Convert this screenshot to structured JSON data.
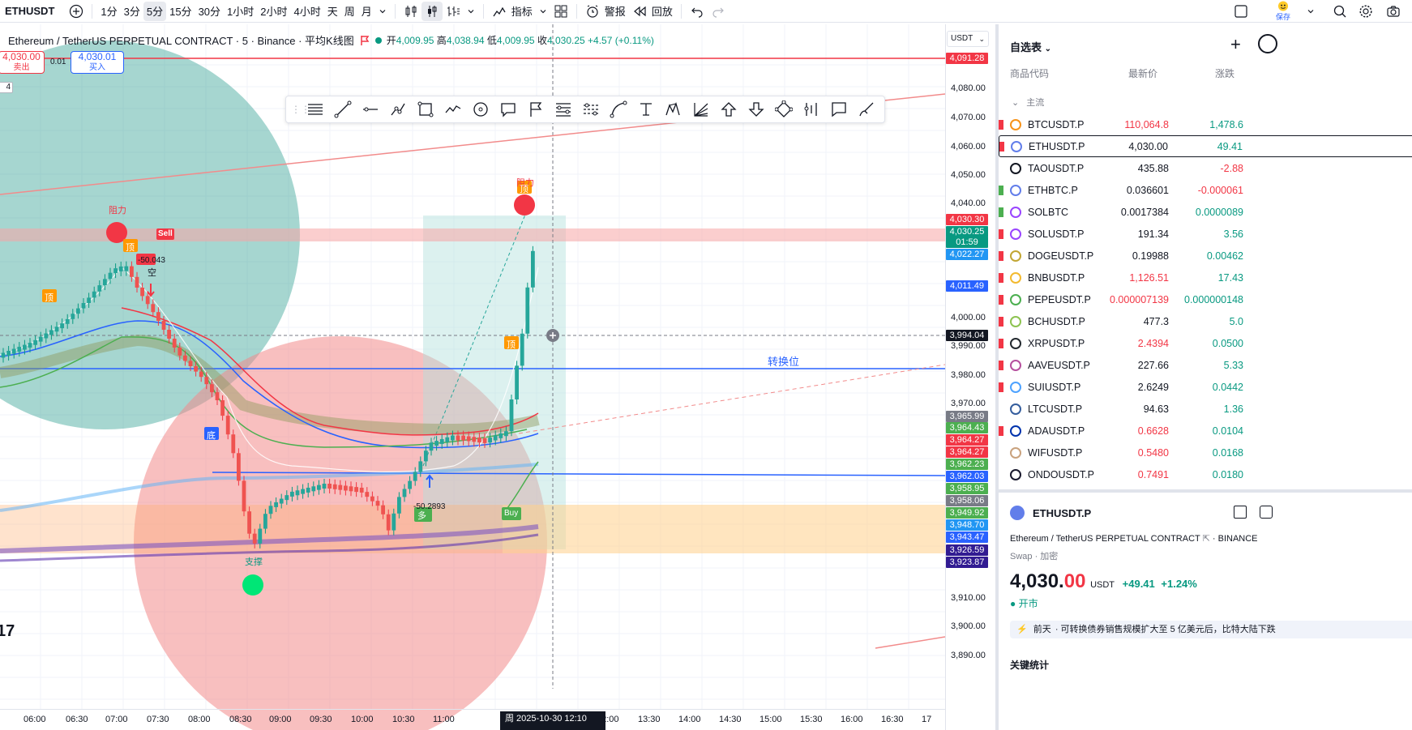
{
  "topbar": {
    "symbol": "ETHUSDT",
    "intervals": [
      "1分",
      "3分",
      "5分",
      "15分",
      "30分",
      "1小时",
      "2小时",
      "4小时",
      "天",
      "周",
      "月"
    ],
    "active_interval": "5分",
    "indicators": "指标",
    "alert": "警报",
    "replay": "回放",
    "save": "保存"
  },
  "legend": {
    "title": "Ethereum / TetherUS PERPETUAL CONTRACT · 5 · Binance · 平均K线图",
    "open_label": "开",
    "open": "4,009.95",
    "high_label": "高",
    "high": "4,038.94",
    "low_label": "低",
    "low": "4,009.95",
    "close_label": "收",
    "close": "4,030.25",
    "change": "+4.57 (+0.11%)"
  },
  "currency": "USDT",
  "orders": {
    "sell_price": "4,030.00",
    "sell_label": "卖出",
    "spread": "0.01",
    "buy_price": "4,030.01",
    "buy_label": "买入",
    "lots": "4"
  },
  "annotations": {
    "resistance_left": "阻力",
    "resistance_right": "阻力",
    "support": "支撑",
    "top": "顶",
    "bottom": "底",
    "sell": "Sell",
    "buy": "Buy",
    "short": "空",
    "long": "多",
    "short_value": "-50.043",
    "long_value": "-50.2893",
    "pivot": "转换位"
  },
  "price_axis": {
    "ticks": [
      "4,080.00",
      "4,070.00",
      "4,060.00",
      "4,050.00",
      "4,040.00",
      "4,000.00",
      "3,990.00",
      "3,980.00",
      "3,970.00",
      "3,910.00",
      "3,900.00",
      "3,890.00"
    ],
    "labels": [
      {
        "v": "4,091.28",
        "c": "#f23645"
      },
      {
        "v": "4,030.30",
        "c": "#f23645"
      },
      {
        "v": "4,030.25",
        "c": "#089981"
      },
      {
        "v": "01:59",
        "c": "#089981"
      },
      {
        "v": "4,022.27",
        "c": "#2196f3"
      },
      {
        "v": "4,011.49",
        "c": "#2962ff"
      },
      {
        "v": "3,994.04",
        "c": "#131722"
      },
      {
        "v": "3,965.99",
        "c": "#787b86"
      },
      {
        "v": "3,964.43",
        "c": "#4caf50"
      },
      {
        "v": "3,964.27",
        "c": "#f23645"
      },
      {
        "v": "3,964.27",
        "c": "#f23645"
      },
      {
        "v": "3,962.23",
        "c": "#4caf50"
      },
      {
        "v": "3,962.03",
        "c": "#2962ff"
      },
      {
        "v": "3,958.95",
        "c": "#4caf50"
      },
      {
        "v": "3,958.06",
        "c": "#787b86"
      },
      {
        "v": "3,949.92",
        "c": "#4caf50"
      },
      {
        "v": "3,948.70",
        "c": "#2196f3"
      },
      {
        "v": "3,943.47",
        "c": "#2962ff"
      },
      {
        "v": "3,926.59",
        "c": "#311b92"
      },
      {
        "v": "3,923.87",
        "c": "#311b92"
      }
    ]
  },
  "time_axis": {
    "ticks": [
      "06:00",
      "06:30",
      "07:00",
      "07:30",
      "08:00",
      "08:30",
      "09:00",
      "09:30",
      "10:00",
      "10:30",
      "11:00",
      "11:",
      "12:00",
      "13:30",
      "14:00",
      "14:30",
      "15:00",
      "15:30",
      "16:00",
      "16:30",
      "17"
    ],
    "cursor": "周 2025-10-30 12:10"
  },
  "watchlist": {
    "title": "自选表",
    "col_symbol": "商品代码",
    "col_last": "最新价",
    "col_change": "涨跌",
    "section": "主流",
    "rows": [
      {
        "sym": "BTCUSDT.P",
        "last": "110,064.8",
        "chg": "1,478.6",
        "lc": "dn",
        "cc": "up",
        "coin": "#f7931a",
        "flag": "#f23645"
      },
      {
        "sym": "ETHUSDT.P",
        "last": "4,030.00",
        "chg": "49.41",
        "lc": "plain",
        "cc": "up",
        "coin": "#627eea",
        "flag": "#f23645"
      },
      {
        "sym": "TAOUSDT.P",
        "last": "435.88",
        "chg": "-2.88",
        "lc": "plain",
        "cc": "dn",
        "coin": "#131722",
        "flag": ""
      },
      {
        "sym": "ETHBTC.P",
        "last": "0.036601",
        "chg": "-0.000061",
        "lc": "plain",
        "cc": "dn",
        "coin": "#627eea",
        "flag": "#4caf50"
      },
      {
        "sym": "SOLBTC",
        "last": "0.0017384",
        "chg": "0.0000089",
        "lc": "plain",
        "cc": "up",
        "coin": "#9945ff",
        "flag": "#4caf50"
      },
      {
        "sym": "SOLUSDT.P",
        "last": "191.34",
        "chg": "3.56",
        "lc": "plain",
        "cc": "up",
        "coin": "#9945ff",
        "flag": "#f23645"
      },
      {
        "sym": "DOGEUSDT.P",
        "last": "0.19988",
        "chg": "0.00462",
        "lc": "plain",
        "cc": "up",
        "coin": "#c2a633",
        "flag": "#f23645"
      },
      {
        "sym": "BNBUSDT.P",
        "last": "1,126.51",
        "chg": "17.43",
        "lc": "dn",
        "cc": "up",
        "coin": "#f3ba2f",
        "flag": "#f23645"
      },
      {
        "sym": "PEPEUSDT.P",
        "last": "0.000007139",
        "chg": "0.000000148",
        "lc": "dn",
        "cc": "up",
        "coin": "#4caf50",
        "flag": "#f23645"
      },
      {
        "sym": "BCHUSDT.P",
        "last": "477.3",
        "chg": "5.0",
        "lc": "plain",
        "cc": "up",
        "coin": "#8dc351",
        "flag": "#f23645"
      },
      {
        "sym": "XRPUSDT.P",
        "last": "2.4394",
        "chg": "0.0500",
        "lc": "dn",
        "cc": "up",
        "coin": "#23292f",
        "flag": "#f23645"
      },
      {
        "sym": "AAVEUSDT.P",
        "last": "227.66",
        "chg": "5.33",
        "lc": "plain",
        "cc": "up",
        "coin": "#b6509e",
        "flag": "#f23645"
      },
      {
        "sym": "SUIUSDT.P",
        "last": "2.6249",
        "chg": "0.0442",
        "lc": "plain",
        "cc": "up",
        "coin": "#4da2ff",
        "flag": "#f23645"
      },
      {
        "sym": "LTCUSDT.P",
        "last": "94.63",
        "chg": "1.36",
        "lc": "plain",
        "cc": "up",
        "coin": "#345d9d",
        "flag": ""
      },
      {
        "sym": "ADAUSDT.P",
        "last": "0.6628",
        "chg": "0.0104",
        "lc": "dn",
        "cc": "up",
        "coin": "#0033ad",
        "flag": "#f23645"
      },
      {
        "sym": "WIFUSDT.P",
        "last": "0.5480",
        "chg": "0.0168",
        "lc": "dn",
        "cc": "up",
        "coin": "#c9a27e",
        "flag": ""
      },
      {
        "sym": "ONDOUSDT.P",
        "last": "0.7491",
        "chg": "0.0180",
        "lc": "dn",
        "cc": "up",
        "coin": "#1a1a2e",
        "flag": ""
      }
    ]
  },
  "details": {
    "symbol": "ETHUSDT.P",
    "name": "Ethereum / TetherUS PERPETUAL CONTRACT",
    "exchange": "BINANCE",
    "type": "Swap · 加密",
    "price": "4,030.",
    "price_dec": "00",
    "currency": "USDT",
    "change": "+49.41",
    "change_pct": "+1.24%",
    "market": "开市",
    "news_day": "前天",
    "news": "· 可转换债券销售规模扩大至 5 亿美元后，比特大陆下跌",
    "key_stats": "关键统计"
  },
  "colors": {
    "up": "#089981",
    "down": "#f23645",
    "accent": "#2962ff"
  }
}
